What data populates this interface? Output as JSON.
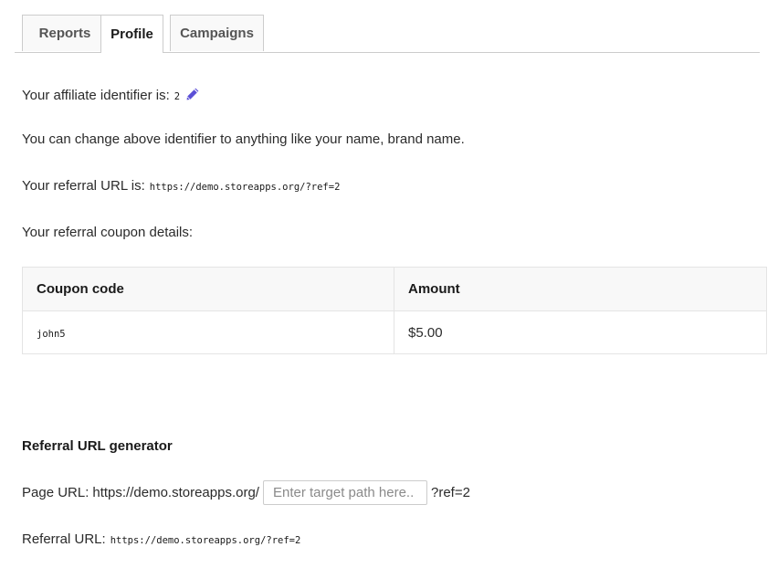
{
  "tabs": [
    {
      "label": "Reports"
    },
    {
      "label": "Profile"
    },
    {
      "label": "Campaigns"
    }
  ],
  "profile": {
    "identifier_label": "Your affiliate identifier is:",
    "identifier_value": "2",
    "change_note": "You can change above identifier to anything like your name, brand name.",
    "referral_url_label": "Your referral URL is:",
    "referral_url_value": "https://demo.storeapps.org/?ref=2",
    "coupon_details_label": "Your referral coupon details:"
  },
  "coupon_table": {
    "headers": [
      "Coupon code",
      "Amount"
    ],
    "rows": [
      {
        "code": "john5",
        "amount": "$5.00"
      }
    ]
  },
  "generator": {
    "heading": "Referral URL generator",
    "page_url_label": "Page URL:",
    "page_url_base": "https://demo.storeapps.org/",
    "path_placeholder": "Enter target path here..",
    "ref_suffix": "?ref=2",
    "result_label": "Referral URL:",
    "result_value": "https://demo.storeapps.org/?ref=2"
  },
  "colors": {
    "accent_icon": "#5b4fd6",
    "border": "#cccccc"
  },
  "icons": {
    "edit": "pencil-icon"
  }
}
